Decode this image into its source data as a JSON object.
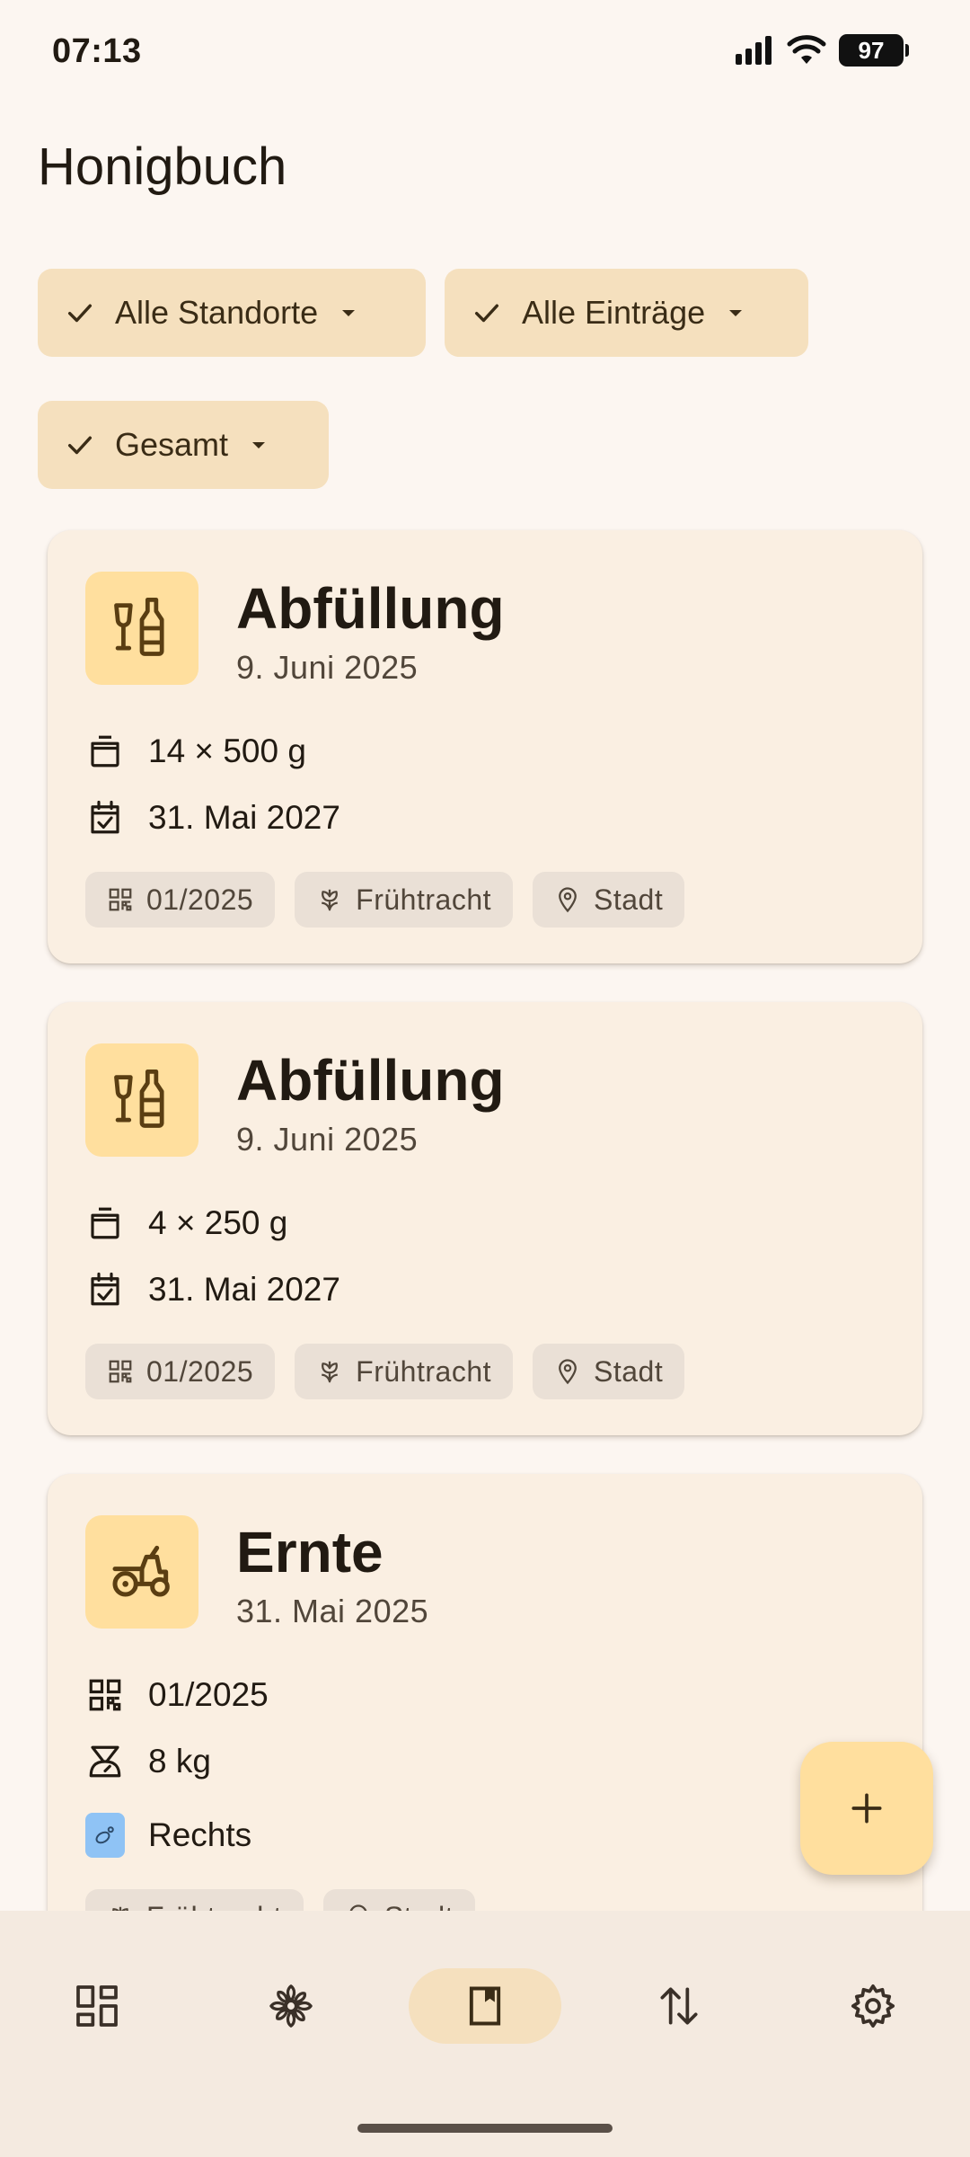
{
  "status_bar": {
    "time": "07:13",
    "battery": "97"
  },
  "app": {
    "title": "Honigbuch"
  },
  "filters": [
    {
      "label": "Alle Standorte"
    },
    {
      "label": "Alle Einträge"
    },
    {
      "label": "Gesamt"
    }
  ],
  "entries": [
    {
      "icon": "bottle-glass-icon",
      "title": "Abfüllung",
      "date": "9. Juni 2025",
      "quantity": "14 × 500 g",
      "best_before": "31. Mai 2027",
      "tags": {
        "batch": "01/2025",
        "flora": "Frühtracht",
        "location": "Stadt"
      }
    },
    {
      "icon": "bottle-glass-icon",
      "title": "Abfüllung",
      "date": "9. Juni 2025",
      "quantity": "4 × 250 g",
      "best_before": "31. Mai 2027",
      "tags": {
        "batch": "01/2025",
        "flora": "Frühtracht",
        "location": "Stadt"
      }
    },
    {
      "icon": "tractor-icon",
      "title": "Ernte",
      "date": "31. Mai 2025",
      "batch": "01/2025",
      "weight": "8 kg",
      "hive": "Rechts",
      "tags": {
        "flora": "Frühtracht",
        "location": "Stadt"
      }
    }
  ],
  "fab": {
    "icon": "plus-icon"
  },
  "nav": {
    "items": [
      {
        "name": "dashboard",
        "icon": "grid-icon"
      },
      {
        "name": "flowers",
        "icon": "flower-icon"
      },
      {
        "name": "journal",
        "icon": "book-icon",
        "active": true
      },
      {
        "name": "transfer",
        "icon": "swap-vertical-icon"
      },
      {
        "name": "settings",
        "icon": "gear-icon"
      }
    ]
  },
  "colors": {
    "background": "#FCF6F1",
    "accent": "#FFDF9E",
    "chip": "#F5E0BE",
    "card": "#FAEFE2"
  }
}
